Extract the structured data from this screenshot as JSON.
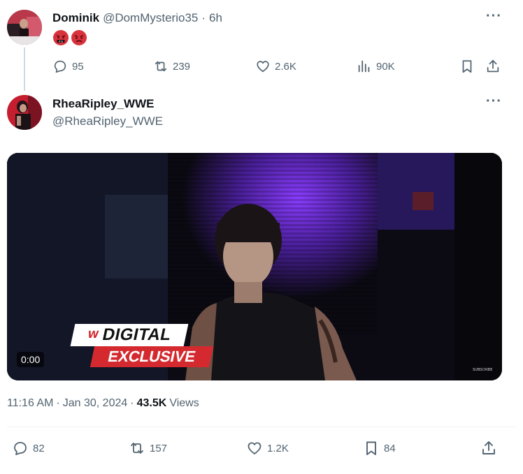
{
  "reply_tweet": {
    "display_name": "Dominik",
    "handle": "@DomMysterio35",
    "separator": "·",
    "time": "6h",
    "emojis": [
      "angry-face-emoji",
      "angry-face-emoji"
    ],
    "metrics": {
      "replies": "95",
      "retweets": "239",
      "likes": "2.6K",
      "views": "90K"
    }
  },
  "main_tweet": {
    "display_name": "RheaRipley_WWE",
    "handle": "@RheaRipley_WWE",
    "video": {
      "duration": "0:00",
      "badge_top": "DIGITAL",
      "badge_bottom": "EXCLUSIVE",
      "brand": "W",
      "watermark": "SUBSCRIBE"
    },
    "timestamp_time": "11:16 AM",
    "separator": "·",
    "timestamp_date": "Jan 30, 2024",
    "views_count": "43.5K",
    "views_label": "Views",
    "metrics": {
      "replies": "82",
      "retweets": "157",
      "likes": "1.2K",
      "bookmarks": "84"
    }
  },
  "colors": {
    "text_primary": "#0f1419",
    "text_secondary": "#536471",
    "divider": "#eff3f4",
    "thread_line": "#cfd9de",
    "badge_white": "#ffffff",
    "badge_red": "#d42a2f"
  },
  "more_label": "···"
}
